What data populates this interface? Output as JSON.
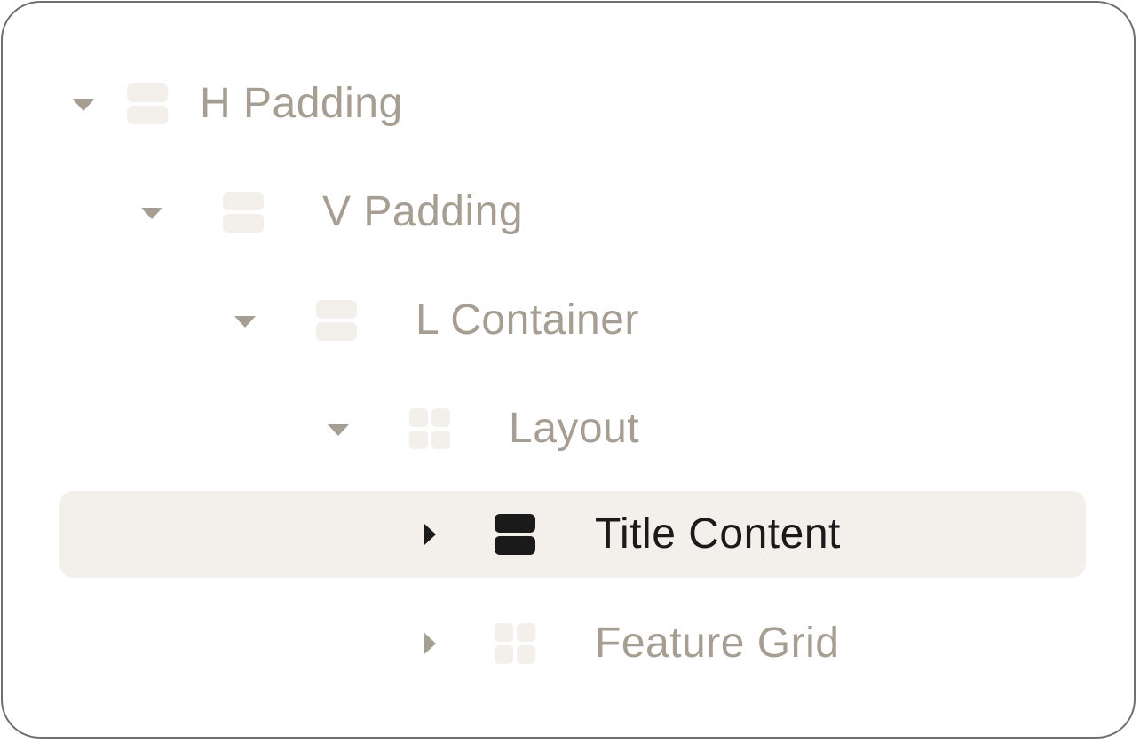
{
  "tree": {
    "items": [
      {
        "label": "H Padding",
        "expanded": true,
        "icon": "stack-icon",
        "depth": 0,
        "selected": false
      },
      {
        "label": "V Padding",
        "expanded": true,
        "icon": "stack-icon",
        "depth": 1,
        "selected": false
      },
      {
        "label": "L Container",
        "expanded": true,
        "icon": "stack-icon",
        "depth": 2,
        "selected": false
      },
      {
        "label": "Layout",
        "expanded": true,
        "icon": "grid-icon",
        "depth": 3,
        "selected": false
      },
      {
        "label": "Title Content",
        "expanded": false,
        "icon": "stack-icon",
        "depth": 4,
        "selected": true
      },
      {
        "label": "Feature Grid",
        "expanded": false,
        "icon": "grid-icon",
        "depth": 4,
        "selected": false
      }
    ]
  },
  "colors": {
    "muted_text": "#a69e92",
    "selected_text": "#1a1a1a",
    "selected_background": "#f3f0eb",
    "icon_fill": "#f3f0eb",
    "border": "#6f6f6f"
  }
}
